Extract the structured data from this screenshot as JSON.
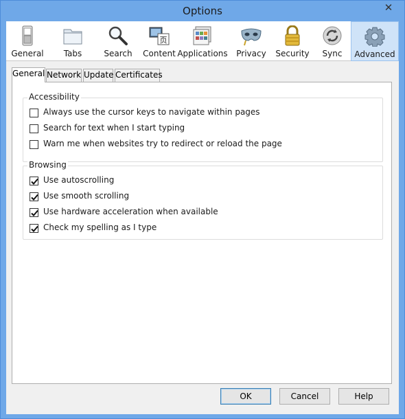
{
  "window": {
    "title": "Options",
    "close_glyph": "✕"
  },
  "toolbar": {
    "items": [
      {
        "label": "General",
        "icon": "switch-icon"
      },
      {
        "label": "Tabs",
        "icon": "folder-tabs-icon"
      },
      {
        "label": "Search",
        "icon": "magnifier-icon"
      },
      {
        "label": "Content",
        "icon": "content-icon"
      },
      {
        "label": "Applications",
        "icon": "applications-icon"
      },
      {
        "label": "Privacy",
        "icon": "mask-icon"
      },
      {
        "label": "Security",
        "icon": "padlock-icon"
      },
      {
        "label": "Sync",
        "icon": "sync-icon"
      },
      {
        "label": "Advanced",
        "icon": "gear-icon",
        "selected": true
      }
    ]
  },
  "subtabs": [
    "General",
    "Network",
    "Update",
    "Certificates"
  ],
  "accessibility": {
    "title": "Accessibility",
    "options": [
      {
        "label": "Always use the cursor keys to navigate within pages",
        "checked": false
      },
      {
        "label": "Search for text when I start typing",
        "checked": false
      },
      {
        "label": "Warn me when websites try to redirect or reload the page",
        "checked": false
      }
    ]
  },
  "browsing": {
    "title": "Browsing",
    "options": [
      {
        "label": "Use autoscrolling",
        "checked": true
      },
      {
        "label": "Use smooth scrolling",
        "checked": true
      },
      {
        "label": "Use hardware acceleration when available",
        "checked": true
      },
      {
        "label": "Check my spelling as I type",
        "checked": true
      }
    ]
  },
  "buttons": {
    "ok": "OK",
    "cancel": "Cancel",
    "help": "Help"
  },
  "colors": {
    "titlebar": "#6fa8e8",
    "selected_toolbar": "#cfe3f8",
    "accent": "#3c7fb1"
  }
}
